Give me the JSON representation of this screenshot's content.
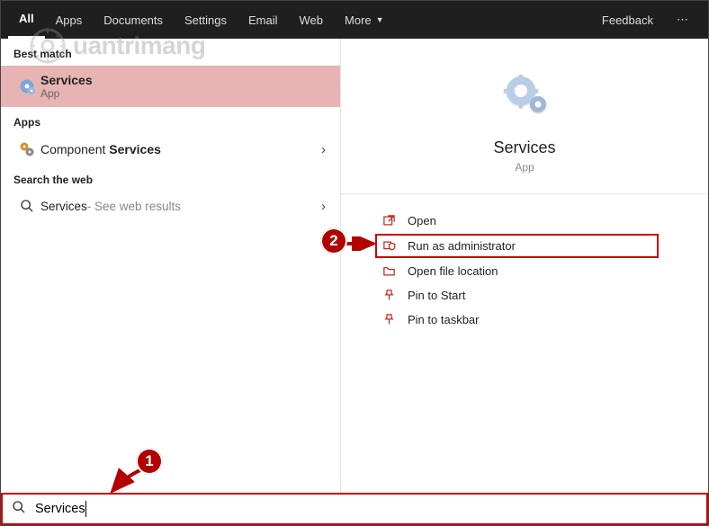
{
  "tabs": {
    "all": "All",
    "apps": "Apps",
    "documents": "Documents",
    "settings": "Settings",
    "email": "Email",
    "web": "Web",
    "more": "More",
    "feedback": "Feedback"
  },
  "left": {
    "best_match_header": "Best match",
    "services_title": "Services",
    "services_sub": "App",
    "apps_header": "Apps",
    "component_pre": "Component ",
    "component_bold": "Services",
    "web_header": "Search the web",
    "web_result_title": "Services",
    "web_result_suffix": " - See web results"
  },
  "detail": {
    "title": "Services",
    "sub": "App",
    "open": "Open",
    "run_admin": "Run as administrator",
    "open_loc": "Open file location",
    "pin_start": "Pin to Start",
    "pin_taskbar": "Pin to taskbar"
  },
  "search": {
    "value": "Services"
  },
  "annot": {
    "one": "1",
    "two": "2"
  },
  "watermark": "uantrimang"
}
